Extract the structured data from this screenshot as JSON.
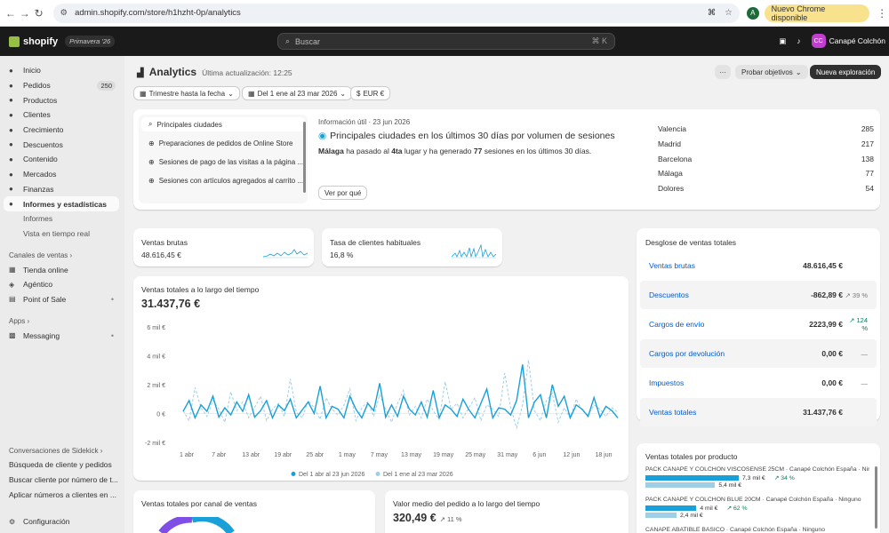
{
  "browser": {
    "url": "admin.shopify.com/store/h1hzht-0p/analytics",
    "profile": "A",
    "update_label": "Nuevo Chrome disponible"
  },
  "topbar": {
    "brand": "shopify",
    "season": "Primavera '26",
    "search_placeholder": "Buscar",
    "shortcut": "⌘ K",
    "store_initials": "CC",
    "store_name": "Canapé Colchón"
  },
  "sidebar": {
    "items": [
      {
        "label": "Inicio",
        "icon": "home-icon"
      },
      {
        "label": "Pedidos",
        "icon": "orders-icon",
        "badge": "250"
      },
      {
        "label": "Productos",
        "icon": "tag-icon"
      },
      {
        "label": "Clientes",
        "icon": "person-icon"
      },
      {
        "label": "Crecimiento",
        "icon": "target-icon"
      },
      {
        "label": "Descuentos",
        "icon": "discount-icon"
      },
      {
        "label": "Contenido",
        "icon": "content-icon"
      },
      {
        "label": "Mercados",
        "icon": "globe-icon"
      },
      {
        "label": "Finanzas",
        "icon": "bank-icon"
      },
      {
        "label": "Informes y estadísticas",
        "icon": "chart-icon",
        "active": true
      }
    ],
    "subitems": [
      "Informes",
      "Vista en tiempo real"
    ],
    "sales_channels_label": "Canales de ventas",
    "channels": [
      "Tienda online",
      "Agéntico",
      "Point of Sale"
    ],
    "apps_label": "Apps",
    "apps": [
      "Messaging"
    ],
    "sidekick_label": "Conversaciones de Sidekick",
    "sidekick": [
      "Búsqueda de cliente y pedidos",
      "Buscar cliente por número de t...",
      "Aplicar números a clientes en ..."
    ],
    "settings": "Configuración"
  },
  "header": {
    "title": "Analytics",
    "updated": "Última actualización: 12:25",
    "btn_goals": "Probar objetivos",
    "btn_new": "Nueva exploración",
    "filter_period": "Trimestre hasta la fecha",
    "filter_compare": "Del 1 ene al 23 mar 2026",
    "filter_currency": "EUR €"
  },
  "insights": {
    "list": [
      "Principales ciudades",
      "Preparaciones de pedidos de Online Store",
      "Sesiones de pago de las visitas a la página ...",
      "Sesiones con artículos agregados al carrito ..."
    ],
    "meta": "Información útil · 23 jun 2026",
    "headline": "Principales ciudades en los últimos 30 días por volumen de sesiones",
    "desc_city": "Málaga",
    "desc_a": " ha pasado al ",
    "desc_rank": "4ta",
    "desc_b": " lugar y ha generado ",
    "desc_num": "77",
    "desc_c": " sesiones en los últimos 30 días.",
    "button": "Ver por qué",
    "cities": [
      {
        "name": "Valencia",
        "value": "285"
      },
      {
        "name": "Madrid",
        "value": "217"
      },
      {
        "name": "Barcelona",
        "value": "138"
      },
      {
        "name": "Málaga",
        "value": "77"
      },
      {
        "name": "Dolores",
        "value": "54"
      }
    ]
  },
  "kpis": {
    "gross_label": "Ventas brutas",
    "gross_value": "48.616,45 €",
    "returning_label": "Tasa de clientes habituales",
    "returning_value": "16,8 %"
  },
  "breakdown": {
    "title": "Desglose de ventas totales",
    "rows": [
      {
        "label": "Ventas brutas",
        "value": "48.616,45 €",
        "trend": ""
      },
      {
        "label": "Descuentos",
        "value": "-862,89 €",
        "trend": "↗ 39 %",
        "up": false
      },
      {
        "label": "Cargos de envío",
        "value": "2223,99 €",
        "trend": "↗ 124 %",
        "up": true
      },
      {
        "label": "Cargos por devolución",
        "value": "0,00 €",
        "trend": "—"
      },
      {
        "label": "Impuestos",
        "value": "0,00 €",
        "trend": "—"
      },
      {
        "label": "Ventas totales",
        "value": "31.437,76 €",
        "trend": ""
      }
    ]
  },
  "sales_over_time": {
    "title": "Ventas totales a lo largo del tiempo",
    "value": "31.437,76 €"
  },
  "chart_data": {
    "type": "line",
    "title": "Ventas totales a lo largo del tiempo",
    "ylim": [
      -2000,
      6000
    ],
    "yticks": [
      "6 mil €",
      "4 mil €",
      "2 mil €",
      "0 €",
      "-2 mil €"
    ],
    "xticks": [
      "1 abr",
      "7 abr",
      "13 abr",
      "19 abr",
      "25 abr",
      "1 may",
      "7 may",
      "13 may",
      "19 may",
      "25 may",
      "31 may",
      "6 jun",
      "12 jun",
      "18 jun"
    ],
    "series": [
      {
        "name": "Del 1 abr al 23 jun 2026",
        "color": "#1aa0d8",
        "values": [
          150,
          900,
          -300,
          600,
          150,
          1200,
          -250,
          400,
          -100,
          800,
          150,
          1300,
          -250,
          200,
          900,
          -300,
          600,
          200,
          1000,
          -300,
          250,
          800,
          0,
          1900,
          -300,
          500,
          300,
          -300,
          1200,
          300,
          -300,
          700,
          200,
          2100,
          -250,
          600,
          -200,
          1200,
          300,
          -100,
          800,
          -250,
          1600,
          -300,
          600,
          300,
          -200,
          1000,
          250,
          -300,
          700,
          1700,
          -300,
          400,
          300,
          -100,
          900,
          3400,
          -300,
          800,
          1300,
          -300,
          2000,
          500,
          1200,
          -300,
          600,
          300,
          -200,
          1100,
          -250,
          500,
          200,
          -300
        ]
      },
      {
        "name": "Del 1 ene al 23 mar 2026",
        "color": "#9ecfe7",
        "values": [
          200,
          -500,
          1800,
          400,
          -200,
          900,
          300,
          -600,
          1500,
          200,
          800,
          -300,
          400,
          1200,
          -500,
          300,
          700,
          -200,
          2400,
          100,
          -300,
          900,
          400,
          -400,
          1100,
          300,
          -100,
          600,
          1700,
          -500,
          400,
          800,
          -200,
          1300,
          300,
          -600,
          700,
          1600,
          -100,
          500,
          -300,
          1000,
          200,
          -400,
          2200,
          300,
          700,
          -300,
          400,
          1100,
          -500,
          600,
          300,
          -200,
          2800,
          400,
          -1000,
          600,
          3700,
          200,
          -500,
          900,
          1400,
          -600,
          400,
          -300,
          1000,
          200,
          -100,
          600,
          300,
          -200,
          400,
          100
        ]
      }
    ]
  },
  "channel_card": {
    "title": "Ventas totales por canal de ventas"
  },
  "aov_card": {
    "title": "Valor medio del pedido a lo largo del tiempo",
    "value": "320,49 €",
    "trend": "↗ 11 %"
  },
  "products": {
    "title": "Ventas totales por producto",
    "items": [
      {
        "name": "PACK CANAPÉ Y COLCHÓN VISCOSENSE 25CM · Canapé Colchón España · Nin...",
        "current": "7,3 mil €",
        "previous": "5,4 mil €",
        "trend": "↗ 34 %",
        "cur_frac": 0.75,
        "prev_frac": 0.56
      },
      {
        "name": "PACK CANAPÉ Y COLCHÓN BLUE 20CM · Canapé Colchón España · Ninguno",
        "current": "4 mil €",
        "previous": "2,4 mil €",
        "trend": "↗ 62 %",
        "cur_frac": 0.41,
        "prev_frac": 0.25
      },
      {
        "name": "CANAPÉ ABATIBLE BÁSICO · Canapé Colchón España · Ninguno",
        "current": "",
        "previous": "",
        "trend": ""
      }
    ]
  },
  "colors": {
    "accent": "#005bd3",
    "series_current": "#1aa0d8",
    "series_previous": "#9ecfe7",
    "topbar": "#1a1a1a",
    "positive": "#047b5d"
  }
}
